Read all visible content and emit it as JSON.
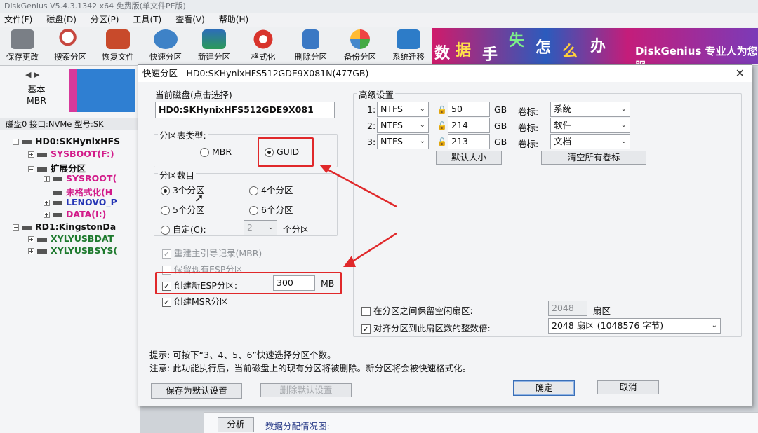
{
  "app": {
    "title": "DiskGenius V5.4.3.1342 x64 免费版(单文件PE版)",
    "menu": [
      "文件(F)",
      "磁盘(D)",
      "分区(P)",
      "工具(T)",
      "查看(V)",
      "帮助(H)"
    ],
    "toolbar": [
      "保存更改",
      "搜索分区",
      "恢复文件",
      "快速分区",
      "新建分区",
      "格式化",
      "删除分区",
      "备份分区",
      "系统迁移"
    ],
    "banner": {
      "chars": [
        "数",
        "据",
        "手",
        "失",
        "怎",
        "么",
        "办"
      ],
      "logo": "DiskGenius 专业人为您服"
    }
  },
  "left_panel": {
    "disk_type_label": "基本",
    "disk_type_value": "MBR",
    "disk_info": "磁盘0 接口:NVMe 型号:SK",
    "tree": [
      {
        "text": "HD0:SKHynixHFS",
        "color": "#111"
      },
      {
        "text": "SYSBOOT(F:)",
        "color": "#d21b8a"
      },
      {
        "text": "扩展分区",
        "color": "#111"
      },
      {
        "text": "SYSROOT(",
        "color": "#d21b8a"
      },
      {
        "text": "未格式化(H",
        "color": "#d21b8a"
      },
      {
        "text": "LENOVO_P",
        "color": "#2434b5"
      },
      {
        "text": "DATA(I:)",
        "color": "#d21b8a"
      },
      {
        "text": "RD1:KingstonDa",
        "color": "#111"
      },
      {
        "text": "XYLYUSBDAT",
        "color": "#1e7a2e"
      },
      {
        "text": "XYLYUSBSYS(",
        "color": "#1e7a2e"
      }
    ]
  },
  "bottom": {
    "analyze_button": "分析",
    "alloc_label": "数据分配情况图:"
  },
  "dialog": {
    "title": "快速分区 - HD0:SKHynixHFS512GDE9X081N(477GB)",
    "current_disk_label": "当前磁盘(点击选择)",
    "current_disk_value": "HD0:SKHynixHFS512GDE9X081",
    "table_type_label": "分区表类型:",
    "table_type_options": [
      "MBR",
      "GUID"
    ],
    "table_type_selected": "GUID",
    "count_label": "分区数目",
    "count_options": [
      "3个分区",
      "4个分区",
      "5个分区",
      "6个分区"
    ],
    "count_selected": "3个分区",
    "custom_label": "自定(C):",
    "custom_value": "2",
    "custom_suffix": "个分区",
    "rebuild_mbr_label": "重建主引导记录(MBR)",
    "keep_esp_label": "保留现有ESP分区",
    "create_esp_label": "创建新ESP分区:",
    "esp_size": "300",
    "esp_unit": "MB",
    "create_msr_label": "创建MSR分区",
    "advanced_label": "高级设置",
    "partitions": [
      {
        "index": "1:",
        "fs": "NTFS",
        "size": "50",
        "unit": "GB",
        "vol_label": "卷标:",
        "vol": "系统"
      },
      {
        "index": "2:",
        "fs": "NTFS",
        "size": "214",
        "unit": "GB",
        "vol_label": "卷标:",
        "vol": "软件"
      },
      {
        "index": "3:",
        "fs": "NTFS",
        "size": "213",
        "unit": "GB",
        "vol_label": "卷标:",
        "vol": "文档"
      }
    ],
    "default_size_button": "默认大小",
    "clear_labels_button": "清空所有卷标",
    "reserve_label": "在分区之间保留空闲扇区:",
    "reserve_value": "2048",
    "reserve_unit": "扇区",
    "align_label": "对齐分区到此扇区数的整数倍:",
    "align_value": "2048 扇区 (1048576 字节)",
    "hint1": "提示: 可按下“3、4、5、6”快速选择分区个数。",
    "hint2": "注意: 此功能执行后，当前磁盘上的现有分区将被删除。新分区将会被快速格式化。",
    "save_default_button": "保存为默认设置",
    "delete_default_button": "删除默认设置",
    "ok_button": "确定",
    "cancel_button": "取消"
  },
  "colors": {
    "highlight": "#e0282a",
    "accent_blue": "#3a6fb7"
  }
}
